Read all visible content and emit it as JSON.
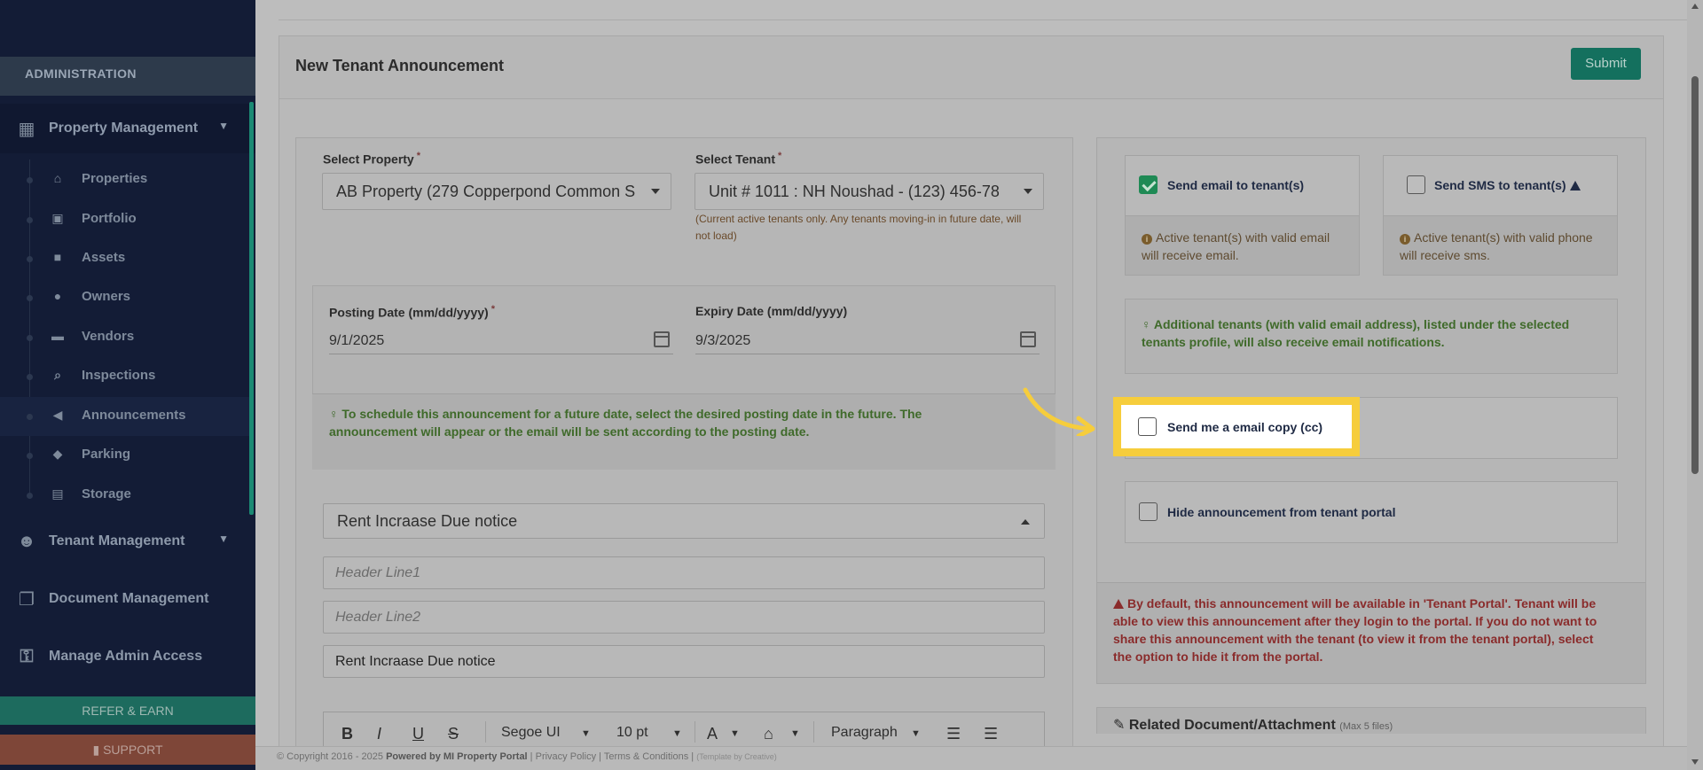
{
  "sidebar": {
    "section_title": "ADMINISTRATION",
    "property_management": "Property Management",
    "sub_items": [
      {
        "label": "Properties",
        "icon": "home-icon"
      },
      {
        "label": "Portfolio",
        "icon": "portfolio-icon"
      },
      {
        "label": "Assets",
        "icon": "assets-icon"
      },
      {
        "label": "Owners",
        "icon": "user-icon"
      },
      {
        "label": "Vendors",
        "icon": "briefcase-icon"
      },
      {
        "label": "Inspections",
        "icon": "search-icon"
      },
      {
        "label": "Announcements",
        "icon": "bullhorn-icon",
        "active": true
      },
      {
        "label": "Parking",
        "icon": "car-icon"
      },
      {
        "label": "Storage",
        "icon": "basket-icon"
      }
    ],
    "tenant_management": "Tenant Management",
    "document_management": "Document Management",
    "manage_admin_access": "Manage Admin Access",
    "refer_label": "REFER & EARN",
    "support_label": "SUPPORT"
  },
  "header": {
    "title": "New Tenant Announcement",
    "submit_label": "Submit"
  },
  "form": {
    "select_property_label": "Select Property",
    "select_property_value": "AB Property (279 Copperpond Common S",
    "select_tenant_label": "Select Tenant",
    "select_tenant_value": "Unit # 1011 : NH Noushad - (123) 456-78",
    "tenant_hint": "(Current active tenants only. Any tenants moving-in in future date, will not load)",
    "posting_date_label": "Posting Date (mm/dd/yyyy)",
    "posting_date_value": "9/1/2025",
    "expiry_date_label": "Expiry Date (mm/dd/yyyy)",
    "expiry_date_value": "9/3/2025",
    "schedule_note": "To schedule this announcement for a future date, select the desired posting date in the future. The announcement will appear or the email will be sent according to the posting date.",
    "template_value": "Rent Incraase Due notice",
    "header_line1_placeholder": "Header Line1",
    "header_line2_placeholder": "Header Line2",
    "subject_value": "Rent Incraase Due notice",
    "toolbar": {
      "bold": "B",
      "italic": "I",
      "underline": "U",
      "strike": "S",
      "font": "Segoe UI",
      "size": "10 pt",
      "text_color": "A",
      "paragraph": "Paragraph"
    }
  },
  "options": {
    "email_label": "Send email to tenant(s)",
    "email_checked": true,
    "email_info": "Active tenant(s) with valid email will receive email.",
    "sms_label": "Send SMS to tenant(s)",
    "sms_checked": false,
    "sms_info": "Active tenant(s) with valid phone will receive sms.",
    "additional_note": "Additional tenants (with valid email address), listed under the selected tenants profile, will also receive email notifications.",
    "cc_label": "Send me a email copy (cc)",
    "cc_checked": false,
    "hide_label": "Hide announcement from tenant portal",
    "hide_checked": false,
    "default_warning": "By default, this announcement will be available in 'Tenant Portal'. Tenant will be able to view this announcement after they login to the portal. If you do not want to share this announcement with the tenant (to view it from the tenant portal), select the option to hide it from the portal."
  },
  "related": {
    "title": "Related Document/Attachment",
    "limit": "(Max 5 files)"
  },
  "footer": {
    "copyright": "© Copyright 2016 - 2025",
    "powered": "Powered by MI Property Portal",
    "privacy": "Privacy Policy",
    "terms": "Terms & Conditions",
    "template_by": "(Template by Creative)"
  },
  "colors": {
    "sidebar": "#131c36",
    "accent_green": "#14705e",
    "highlight": "#f6cd3c",
    "warning_red": "#8a2b2b"
  }
}
